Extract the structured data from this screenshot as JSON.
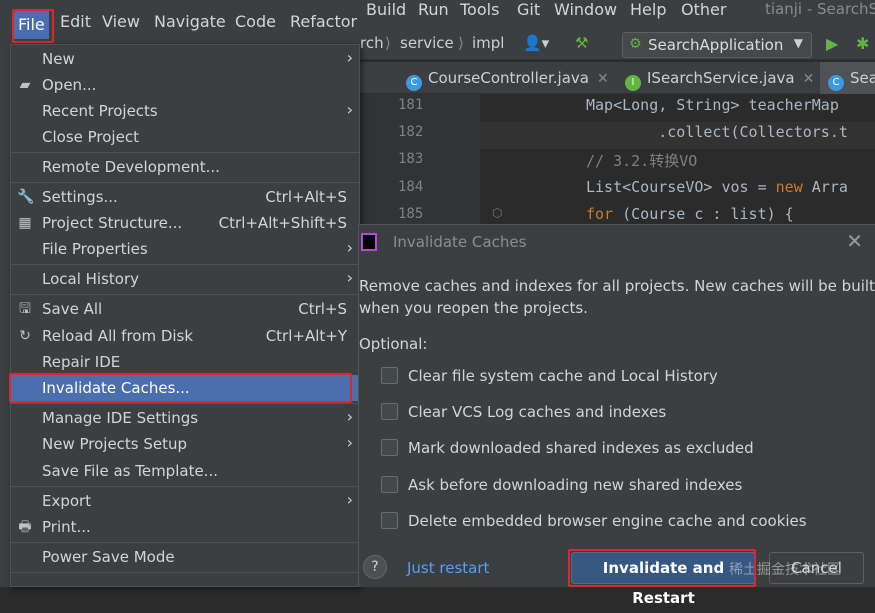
{
  "menubar": {
    "items": [
      "File",
      "Edit",
      "View",
      "Navigate",
      "Code",
      "Refactor",
      "Build",
      "Run",
      "Tools",
      "Git",
      "Window",
      "Help",
      "Other"
    ],
    "window_title": "tianji - SearchSe"
  },
  "nav": {
    "crumbs": [
      "rch",
      "service",
      "impl"
    ],
    "run_config": "SearchApplication"
  },
  "tabs": [
    "CourseController.java",
    "ISearchService.java",
    "Sea"
  ],
  "editor": {
    "line_numbers": [
      "181",
      "182",
      "183",
      "184",
      "185"
    ],
    "lines": [
      {
        "a": "Map<Long, String> teacherMap",
        "kw": "",
        "b": ""
      },
      {
        "a": "        .collect(Collectors.t",
        "kw": "",
        "b": ""
      },
      {
        "a": "// 3.2.转换VO",
        "kw": "",
        "b": ""
      },
      {
        "a": "List<CourseVO> vos = ",
        "kw": "new",
        "b": " Arra"
      },
      {
        "a": "",
        "kw": "for",
        "b": " (Course c : list) {"
      }
    ]
  },
  "file_menu": {
    "items": [
      {
        "label": "New",
        "shortcut": "",
        "submenu": true,
        "icon": ""
      },
      {
        "label": "Open...",
        "shortcut": "",
        "submenu": false,
        "icon": "folder-icon"
      },
      {
        "label": "Recent Projects",
        "shortcut": "",
        "submenu": true,
        "icon": ""
      },
      {
        "label": "Close Project",
        "shortcut": "",
        "submenu": false,
        "icon": ""
      },
      {
        "label": "Remote Development...",
        "shortcut": "",
        "submenu": false,
        "icon": ""
      },
      {
        "label": "Settings...",
        "shortcut": "Ctrl+Alt+S",
        "submenu": false,
        "icon": "wrench-icon"
      },
      {
        "label": "Project Structure...",
        "shortcut": "Ctrl+Alt+Shift+S",
        "submenu": false,
        "icon": "project-structure-icon"
      },
      {
        "label": "File Properties",
        "shortcut": "",
        "submenu": true,
        "icon": ""
      },
      {
        "label": "Local History",
        "shortcut": "",
        "submenu": true,
        "icon": ""
      },
      {
        "label": "Save All",
        "shortcut": "Ctrl+S",
        "submenu": false,
        "icon": "save-icon"
      },
      {
        "label": "Reload All from Disk",
        "shortcut": "Ctrl+Alt+Y",
        "submenu": false,
        "icon": "reload-icon"
      },
      {
        "label": "Repair IDE",
        "shortcut": "",
        "submenu": false,
        "icon": ""
      },
      {
        "label": "Invalidate Caches...",
        "shortcut": "",
        "submenu": false,
        "icon": ""
      },
      {
        "label": "Manage IDE Settings",
        "shortcut": "",
        "submenu": true,
        "icon": ""
      },
      {
        "label": "New Projects Setup",
        "shortcut": "",
        "submenu": true,
        "icon": ""
      },
      {
        "label": "Save File as Template...",
        "shortcut": "",
        "submenu": false,
        "icon": ""
      },
      {
        "label": "Export",
        "shortcut": "",
        "submenu": true,
        "icon": ""
      },
      {
        "label": "Print...",
        "shortcut": "",
        "submenu": false,
        "icon": "print-icon"
      },
      {
        "label": "Power Save Mode",
        "shortcut": "",
        "submenu": false,
        "icon": ""
      }
    ]
  },
  "dialog": {
    "title": "Invalidate Caches",
    "description_line1": "Remove caches and indexes for all projects. New caches will be built",
    "description_line2": "when you reopen the projects.",
    "optional_label": "Optional:",
    "options": [
      "Clear file system cache and Local History",
      "Clear VCS Log caches and indexes",
      "Mark downloaded shared indexes as excluded",
      "Ask before downloading new shared indexes",
      "Delete embedded browser engine cache and cookies"
    ],
    "help_label": "?",
    "just_restart": "Just restart",
    "primary_button": "Invalidate and Restart",
    "cancel_button": "Cancel"
  },
  "watermark": "稀土掘金技术社区",
  "colors": {
    "highlight": "#e0262d",
    "selection": "#4b6eaf",
    "link": "#589df6"
  }
}
